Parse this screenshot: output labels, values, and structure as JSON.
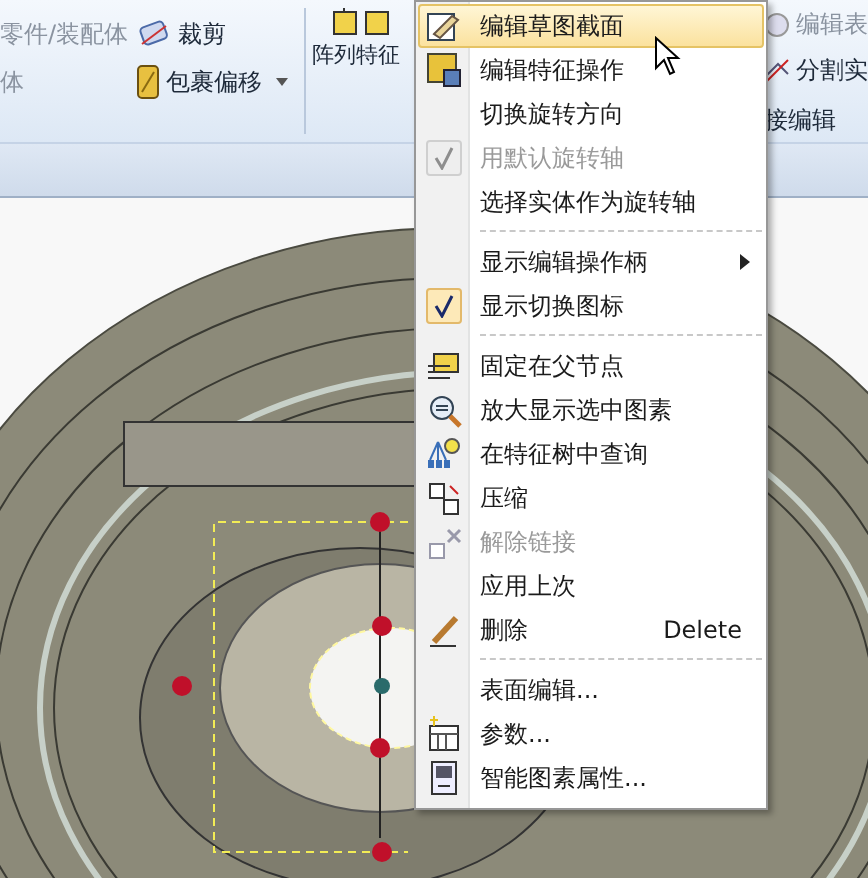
{
  "ribbon": {
    "commands": [
      {
        "label": "零件/装配体",
        "disabled": true,
        "dropdown": false
      },
      {
        "label": "体",
        "disabled": true,
        "dropdown": false
      },
      {
        "label": "裁剪",
        "disabled": false,
        "dropdown": false
      },
      {
        "label": "包裹偏移",
        "disabled": false,
        "dropdown": true
      }
    ],
    "pattern_button": {
      "label": "阵列特征"
    },
    "right_commands": [
      {
        "label": "编辑表",
        "disabled": true
      },
      {
        "label": "分割实",
        "disabled": false
      }
    ],
    "group_label": "接编辑"
  },
  "context_menu": {
    "items": [
      {
        "kind": "item",
        "label": "编辑草图截面",
        "selected": true,
        "disabled": false,
        "checked": false,
        "submenu": false
      },
      {
        "kind": "item",
        "label": "编辑特征操作",
        "selected": false,
        "disabled": false,
        "checked": false,
        "submenu": false
      },
      {
        "kind": "item",
        "label": "切换旋转方向",
        "selected": false,
        "disabled": false,
        "checked": false,
        "submenu": false
      },
      {
        "kind": "item",
        "label": "用默认旋转轴",
        "selected": false,
        "disabled": true,
        "checked": true,
        "submenu": false
      },
      {
        "kind": "item",
        "label": "选择实体作为旋转轴",
        "selected": false,
        "disabled": false,
        "checked": false,
        "submenu": false
      },
      {
        "kind": "separator"
      },
      {
        "kind": "item",
        "label": "显示编辑操作柄",
        "selected": false,
        "disabled": false,
        "checked": false,
        "submenu": true
      },
      {
        "kind": "item",
        "label": "显示切换图标",
        "selected": false,
        "disabled": false,
        "checked": true,
        "submenu": false
      },
      {
        "kind": "separator"
      },
      {
        "kind": "item",
        "label": "固定在父节点",
        "selected": false,
        "disabled": false,
        "checked": false,
        "submenu": false
      },
      {
        "kind": "item",
        "label": "放大显示选中图素",
        "selected": false,
        "disabled": false,
        "checked": false,
        "submenu": false
      },
      {
        "kind": "item",
        "label": "在特征树中查询",
        "selected": false,
        "disabled": false,
        "checked": false,
        "submenu": false
      },
      {
        "kind": "item",
        "label": "压缩",
        "selected": false,
        "disabled": false,
        "checked": false,
        "submenu": false
      },
      {
        "kind": "item",
        "label": "解除链接",
        "selected": false,
        "disabled": true,
        "checked": false,
        "submenu": false
      },
      {
        "kind": "item",
        "label": "应用上次",
        "selected": false,
        "disabled": false,
        "checked": false,
        "submenu": false
      },
      {
        "kind": "item",
        "label": "删除",
        "shortcut": "Delete",
        "selected": false,
        "disabled": false,
        "checked": false,
        "submenu": false
      },
      {
        "kind": "separator"
      },
      {
        "kind": "item",
        "label": "表面编辑...",
        "selected": false,
        "disabled": false,
        "checked": false,
        "submenu": false
      },
      {
        "kind": "item",
        "label": "参数...",
        "selected": false,
        "disabled": false,
        "checked": false,
        "submenu": false
      },
      {
        "kind": "item",
        "label": "智能图素属性...",
        "selected": false,
        "disabled": false,
        "checked": false,
        "submenu": false
      }
    ]
  }
}
